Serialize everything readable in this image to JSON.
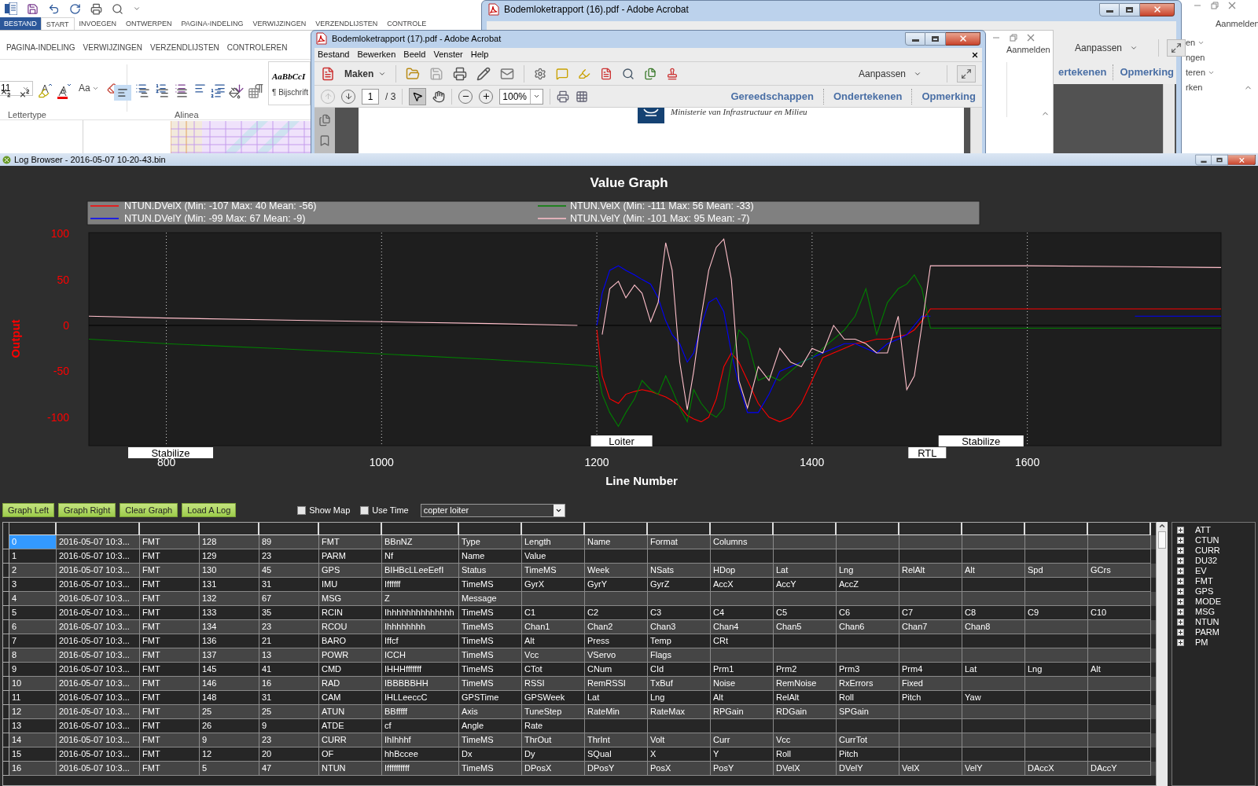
{
  "word_back": {
    "tabs": [
      {
        "label": "BESTAND",
        "kind": "file",
        "selected": false
      },
      {
        "label": "START",
        "kind": "tab",
        "selected": true
      },
      {
        "label": "INVOEGEN",
        "kind": "tab",
        "selected": false
      },
      {
        "label": "ONTWERPEN",
        "kind": "tab",
        "selected": false
      },
      {
        "label": "PAGINA-INDELING",
        "kind": "tab",
        "selected": false
      },
      {
        "label": "VERWIJZINGEN",
        "kind": "tab",
        "selected": false
      },
      {
        "label": "VERZENDLIJSTEN",
        "kind": "tab",
        "selected": false
      },
      {
        "label": "CONTROLE",
        "kind": "tab",
        "selected": false
      }
    ],
    "account": "Aanmelden",
    "ribbon_fragments": [
      {
        "label": "en",
        "dropdown": true
      },
      {
        "label": "ngen",
        "dropdown": false
      },
      {
        "label": "teren",
        "dropdown": true
      },
      {
        "label": "rken",
        "dropdown": false
      }
    ]
  },
  "acrobat_back": {
    "title": "Bodemloketrapport (16).pdf - Adobe Acrobat",
    "customize": "Aanpassen",
    "links": [
      "ertekenen",
      "Opmerking"
    ]
  },
  "word_front": {
    "tabs": [
      "PAGINA-INDELING",
      "VERWIJZINGEN",
      "VERZENDLIJSTEN",
      "CONTROLEREN"
    ],
    "font_size": "11",
    "case_button": "Aa",
    "groups": [
      "Lettertype",
      "Alinea"
    ],
    "style_preview": "AaBbCcI",
    "style_name": "¶ Bijschrift",
    "account": "Aanmelden"
  },
  "acrobat_front": {
    "title": "Bodemloketrapport (17).pdf - Adobe Acrobat",
    "menu": [
      "Bestand",
      "Bewerken",
      "Beeld",
      "Venster",
      "Help"
    ],
    "create": "Maken",
    "customize": "Aanpassen",
    "page": "1",
    "page_count": "/ 3",
    "zoom": "100%",
    "links": [
      "Gereedschappen",
      "Ondertekenen",
      "Opmerking"
    ],
    "document_text": "Ministerie van Infrastructuur en Milieu"
  },
  "log_browser": {
    "title": "Log Browser - 2016-05-07 10-20-43.bin",
    "graph": {
      "chart_data": {
        "type": "line",
        "title": "Value Graph",
        "xlabel": "Line Number",
        "ylabel": "Output",
        "x": [
          728,
          800,
          900,
          1000,
          1100,
          1182,
          1200,
          1205,
          1212,
          1220,
          1227,
          1235,
          1242,
          1250,
          1257,
          1264,
          1270,
          1277,
          1284,
          1290,
          1297,
          1304,
          1311,
          1318,
          1325,
          1332,
          1340,
          1350,
          1360,
          1370,
          1380,
          1390,
          1400,
          1410,
          1420,
          1430,
          1440,
          1450,
          1460,
          1470,
          1480,
          1488,
          1495,
          1502,
          1510,
          1520,
          1600,
          1700,
          1780
        ],
        "series": [
          {
            "name": "NTUN.DVelX (Min: -107 Max: 40 Mean: -56)",
            "color": "#ff0000",
            "values": [
              null,
              null,
              null,
              null,
              null,
              null,
              -5,
              -55,
              -80,
              -85,
              -75,
              -72,
              -70,
              -72,
              -75,
              -78,
              -82,
              -88,
              -98,
              -102,
              -105,
              -100,
              -80,
              -45,
              -30,
              -40,
              -60,
              -85,
              -100,
              -105,
              -100,
              -85,
              -60,
              -35,
              -30,
              -25,
              -20,
              -18,
              -15,
              -15,
              -12,
              -10,
              -5,
              5,
              18,
              18,
              18,
              18,
              18
            ]
          },
          {
            "name": "NTUN.DVelY (Min: -99 Max: 67 Mean: -9)",
            "color": "#0000ff",
            "values": [
              null,
              null,
              null,
              null,
              null,
              null,
              0,
              35,
              60,
              65,
              60,
              55,
              50,
              45,
              30,
              5,
              -10,
              -20,
              -40,
              -30,
              0,
              25,
              30,
              15,
              -30,
              -65,
              -95,
              -95,
              -75,
              -50,
              -45,
              -40,
              -35,
              -30,
              -25,
              -20,
              -20,
              -25,
              -30,
              -20,
              -15,
              -10,
              0,
              10,
              10,
              null,
              null,
              10,
              10
            ]
          },
          {
            "name": "NTUN.VelX (Min: -111 Max: 56 Mean: -33)",
            "color": "#008000",
            "values": [
              -15,
              -20,
              -25,
              -31,
              -37,
              -43,
              -45,
              -75,
              -95,
              -110,
              -95,
              -80,
              -60,
              -70,
              -75,
              -55,
              -70,
              -90,
              -105,
              -70,
              -85,
              -95,
              -100,
              -90,
              -40,
              -5,
              -15,
              -60,
              -55,
              -60,
              -50,
              -40,
              -35,
              -25,
              -15,
              -5,
              10,
              40,
              -10,
              25,
              40,
              45,
              55,
              40,
              -3,
              -3,
              -3,
              -3,
              -3
            ]
          },
          {
            "name": "NTUN.VelY (Min: -101 Max: 95 Mean: -7)",
            "color": "#ffc0cb",
            "values": [
              10,
              8,
              6,
              4,
              2,
              0,
              null,
              -10,
              40,
              48,
              30,
              44,
              35,
              4,
              25,
              90,
              60,
              -40,
              -92,
              -50,
              10,
              60,
              85,
              94,
              50,
              -60,
              -90,
              -45,
              -60,
              -25,
              -40,
              -45,
              -25,
              -30,
              0,
              -15,
              -15,
              -20,
              -30,
              -30,
              10,
              -70,
              -55,
              0,
              65,
              65,
              65,
              64,
              63
            ]
          }
        ],
        "xlim": [
          728,
          1780
        ],
        "ylim": [
          -131,
          101
        ],
        "xticks": [
          800,
          1000,
          1200,
          1400,
          1600
        ],
        "yticks": [
          -100,
          -50,
          0,
          50,
          100
        ],
        "grid": true,
        "legend": "top",
        "annotations": [
          "Stabilize",
          "Loiter",
          "RTL",
          "Stabilize"
        ]
      }
    },
    "buttons": [
      "Graph Left",
      "Graph Right",
      "Clear Graph",
      "Load A Log"
    ],
    "options": [
      {
        "label": "Show Map",
        "checked": false
      },
      {
        "label": "Use Time",
        "checked": false
      }
    ],
    "log_select": {
      "value": "copter loiter"
    },
    "table": {
      "rows": [
        {
          "selected": true,
          "cells": [
            "0",
            "2016-05-07 10:3...",
            "FMT",
            "128",
            "89",
            "FMT",
            "BBnNZ",
            "Type",
            "Length",
            "Name",
            "Format",
            "Columns"
          ]
        },
        {
          "selected": false,
          "cells": [
            "1",
            "2016-05-07 10:3...",
            "FMT",
            "129",
            "23",
            "PARM",
            "Nf",
            "Name",
            "Value"
          ]
        },
        {
          "selected": false,
          "cells": [
            "2",
            "2016-05-07 10:3...",
            "FMT",
            "130",
            "45",
            "GPS",
            "BIHBcLLeeEefI",
            "Status",
            "TimeMS",
            "Week",
            "NSats",
            "HDop",
            "Lat",
            "Lng",
            "RelAlt",
            "Alt",
            "Spd",
            "GCrs"
          ]
        },
        {
          "selected": false,
          "cells": [
            "3",
            "2016-05-07 10:3...",
            "FMT",
            "131",
            "31",
            "IMU",
            "Iffffff",
            "TimeMS",
            "GyrX",
            "GyrY",
            "GyrZ",
            "AccX",
            "AccY",
            "AccZ"
          ]
        },
        {
          "selected": false,
          "cells": [
            "4",
            "2016-05-07 10:3...",
            "FMT",
            "132",
            "67",
            "MSG",
            "Z",
            "Message"
          ]
        },
        {
          "selected": false,
          "cells": [
            "5",
            "2016-05-07 10:3...",
            "FMT",
            "133",
            "35",
            "RCIN",
            "Ihhhhhhhhhhhhhh",
            "TimeMS",
            "C1",
            "C2",
            "C3",
            "C4",
            "C5",
            "C6",
            "C7",
            "C8",
            "C9",
            "C10"
          ]
        },
        {
          "selected": false,
          "cells": [
            "6",
            "2016-05-07 10:3...",
            "FMT",
            "134",
            "23",
            "RCOU",
            "Ihhhhhhhh",
            "TimeMS",
            "Chan1",
            "Chan2",
            "Chan3",
            "Chan4",
            "Chan5",
            "Chan6",
            "Chan7",
            "Chan8"
          ]
        },
        {
          "selected": false,
          "cells": [
            "7",
            "2016-05-07 10:3...",
            "FMT",
            "136",
            "21",
            "BARO",
            "Iffcf",
            "TimeMS",
            "Alt",
            "Press",
            "Temp",
            "CRt"
          ]
        },
        {
          "selected": false,
          "cells": [
            "8",
            "2016-05-07 10:3...",
            "FMT",
            "137",
            "13",
            "POWR",
            "ICCH",
            "TimeMS",
            "Vcc",
            "VServo",
            "Flags"
          ]
        },
        {
          "selected": false,
          "cells": [
            "9",
            "2016-05-07 10:3...",
            "FMT",
            "145",
            "41",
            "CMD",
            "IHHHfffffff",
            "TimeMS",
            "CTot",
            "CNum",
            "CId",
            "Prm1",
            "Prm2",
            "Prm3",
            "Prm4",
            "Lat",
            "Lng",
            "Alt"
          ]
        },
        {
          "selected": false,
          "cells": [
            "10",
            "2016-05-07 10:3...",
            "FMT",
            "146",
            "16",
            "RAD",
            "IBBBBBHH",
            "TimeMS",
            "RSSI",
            "RemRSSI",
            "TxBuf",
            "Noise",
            "RemNoise",
            "RxErrors",
            "Fixed"
          ]
        },
        {
          "selected": false,
          "cells": [
            "11",
            "2016-05-07 10:3...",
            "FMT",
            "148",
            "31",
            "CAM",
            "IHLLeeccC",
            "GPSTime",
            "GPSWeek",
            "Lat",
            "Lng",
            "Alt",
            "RelAlt",
            "Roll",
            "Pitch",
            "Yaw"
          ]
        },
        {
          "selected": false,
          "cells": [
            "12",
            "2016-05-07 10:3...",
            "FMT",
            "25",
            "25",
            "ATUN",
            "BBfffff",
            "Axis",
            "TuneStep",
            "RateMin",
            "RateMax",
            "RPGain",
            "RDGain",
            "SPGain"
          ]
        },
        {
          "selected": false,
          "cells": [
            "13",
            "2016-05-07 10:3...",
            "FMT",
            "26",
            "9",
            "ATDE",
            "cf",
            "Angle",
            "Rate"
          ]
        },
        {
          "selected": false,
          "cells": [
            "14",
            "2016-05-07 10:3...",
            "FMT",
            "9",
            "23",
            "CURR",
            "IhIhhhf",
            "TimeMS",
            "ThrOut",
            "ThrInt",
            "Volt",
            "Curr",
            "Vcc",
            "CurrTot"
          ]
        },
        {
          "selected": false,
          "cells": [
            "15",
            "2016-05-07 10:3...",
            "FMT",
            "12",
            "20",
            "OF",
            "hhBccee",
            "Dx",
            "Dy",
            "SQual",
            "X",
            "Y",
            "Roll",
            "Pitch"
          ]
        },
        {
          "selected": false,
          "cells": [
            "16",
            "2016-05-07 10:3...",
            "FMT",
            "5",
            "47",
            "NTUN",
            "Iffffffffff",
            "TimeMS",
            "DPosX",
            "DPosY",
            "PosX",
            "PosY",
            "DVelX",
            "DVelY",
            "VelX",
            "VelY",
            "DAccX",
            "DAccY"
          ]
        }
      ]
    },
    "tree": [
      {
        "label": "ATT",
        "expanded": false
      },
      {
        "label": "CTUN",
        "expanded": false
      },
      {
        "label": "CURR",
        "expanded": false
      },
      {
        "label": "DU32",
        "expanded": false
      },
      {
        "label": "EV",
        "expanded": false
      },
      {
        "label": "FMT",
        "expanded": false
      },
      {
        "label": "GPS",
        "expanded": false
      },
      {
        "label": "MODE",
        "expanded": false
      },
      {
        "label": "MSG",
        "expanded": false
      },
      {
        "label": "NTUN",
        "expanded": false
      },
      {
        "label": "PARM",
        "expanded": false
      },
      {
        "label": "PM",
        "expanded": false
      }
    ]
  }
}
